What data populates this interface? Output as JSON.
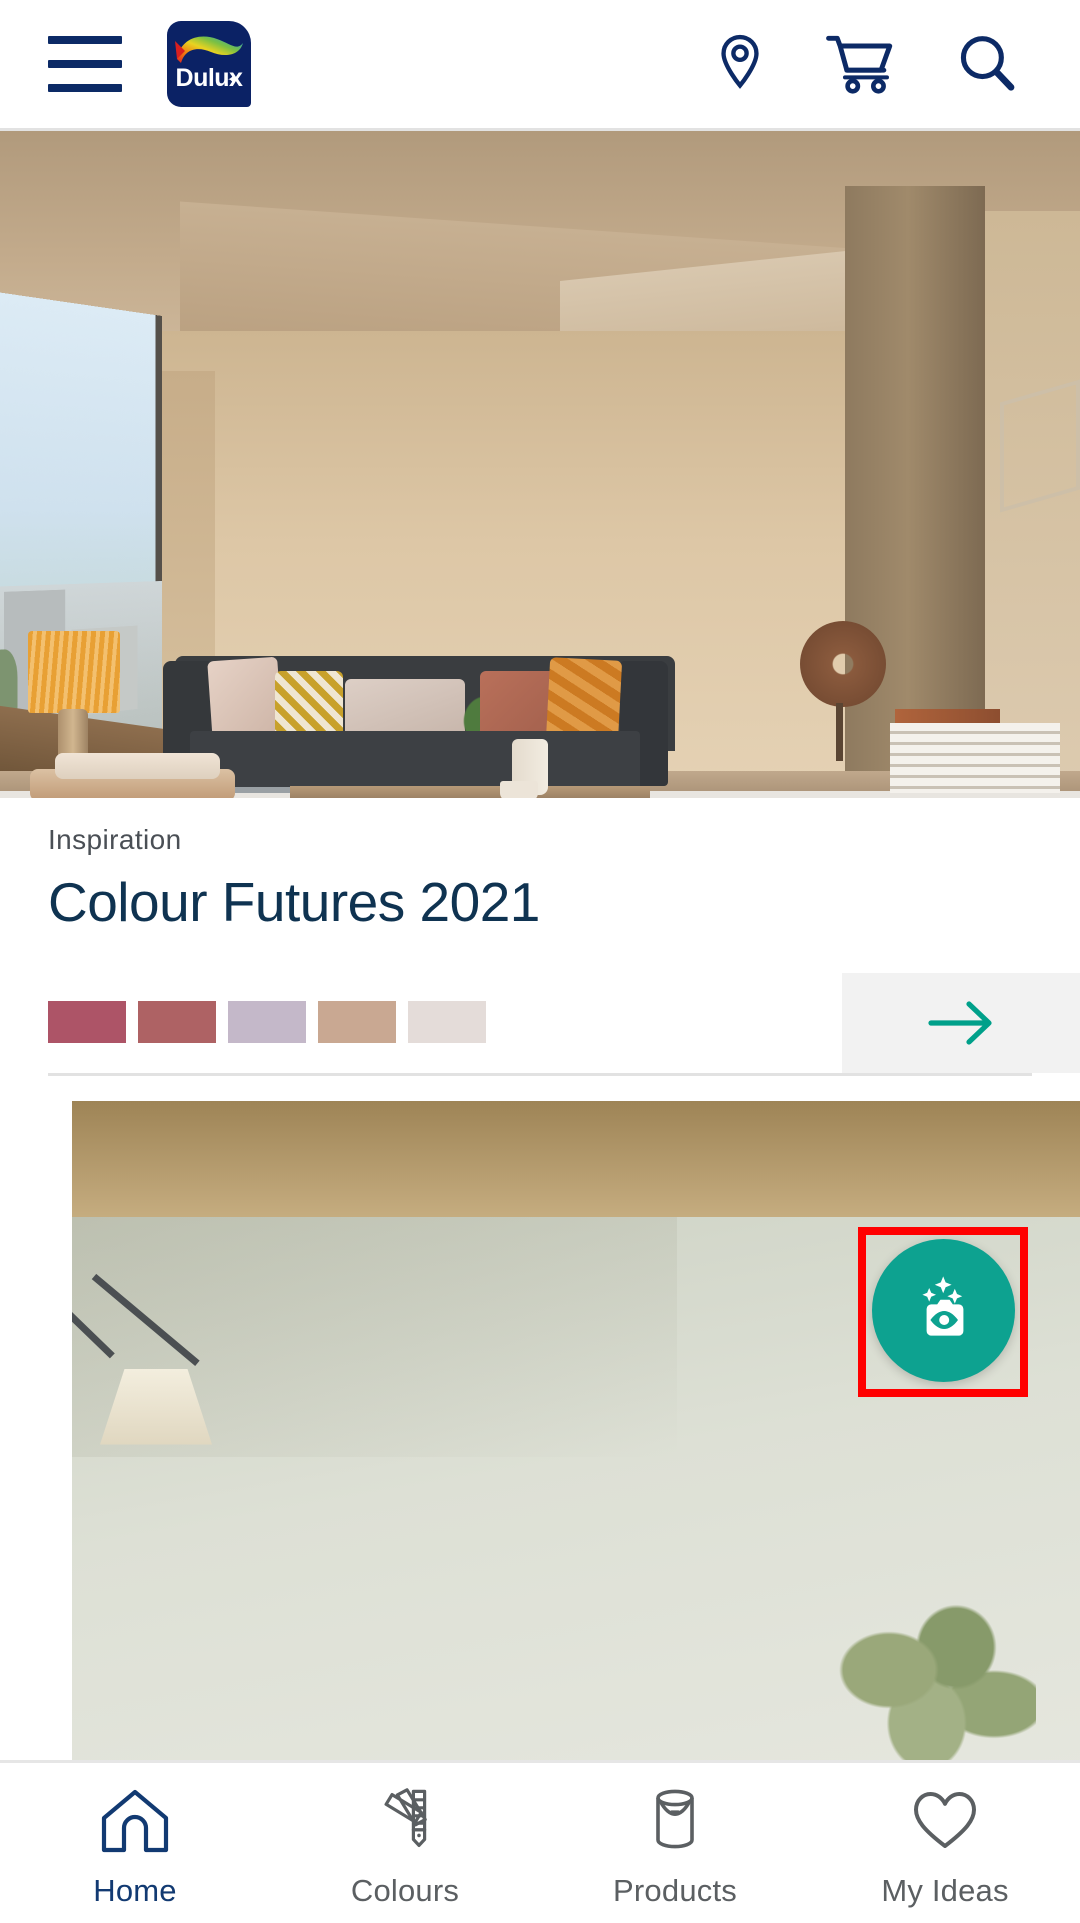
{
  "header": {
    "menu_label": "Menu",
    "logo_text": "Dulux",
    "actions": [
      {
        "name": "store-locator",
        "icon": "location-pin-icon"
      },
      {
        "name": "cart",
        "icon": "shopping-cart-icon"
      },
      {
        "name": "search",
        "icon": "search-icon"
      }
    ],
    "brand_color": "#0b2265"
  },
  "hero_card": {
    "image_alt": "Living room with beige walls, dark grey sofa and large window",
    "eyebrow": "Inspiration",
    "title": "Colour Futures 2021",
    "swatches": [
      {
        "label": "swatch-1",
        "hex": "#AD5467"
      },
      {
        "label": "swatch-2",
        "hex": "#AE6264"
      },
      {
        "label": "swatch-3",
        "hex": "#C4B8C9"
      },
      {
        "label": "swatch-4",
        "hex": "#C9A892"
      },
      {
        "label": "swatch-5",
        "hex": "#E4DCD9"
      }
    ],
    "arrow_icon": "arrow-right-icon",
    "arrow_color": "#00a08a",
    "arrow_bg": "#f2f2f2"
  },
  "second_card": {
    "image_alt": "Room with sage green wall, tan ceiling and floor lamp",
    "fab": {
      "icon": "camera-sparkle-icon",
      "label": "Visualizer camera",
      "color": "#0da290",
      "highlight_color": "#ff0000"
    }
  },
  "bottom_nav": {
    "items": [
      {
        "label": "Home",
        "icon": "home-icon",
        "active": true
      },
      {
        "label": "Colours",
        "icon": "colour-fan-icon",
        "active": false
      },
      {
        "label": "Products",
        "icon": "paint-can-icon",
        "active": false
      },
      {
        "label": "My Ideas",
        "icon": "heart-icon",
        "active": false
      }
    ],
    "active_color": "#123a72",
    "inactive_color": "#5b5f62"
  }
}
